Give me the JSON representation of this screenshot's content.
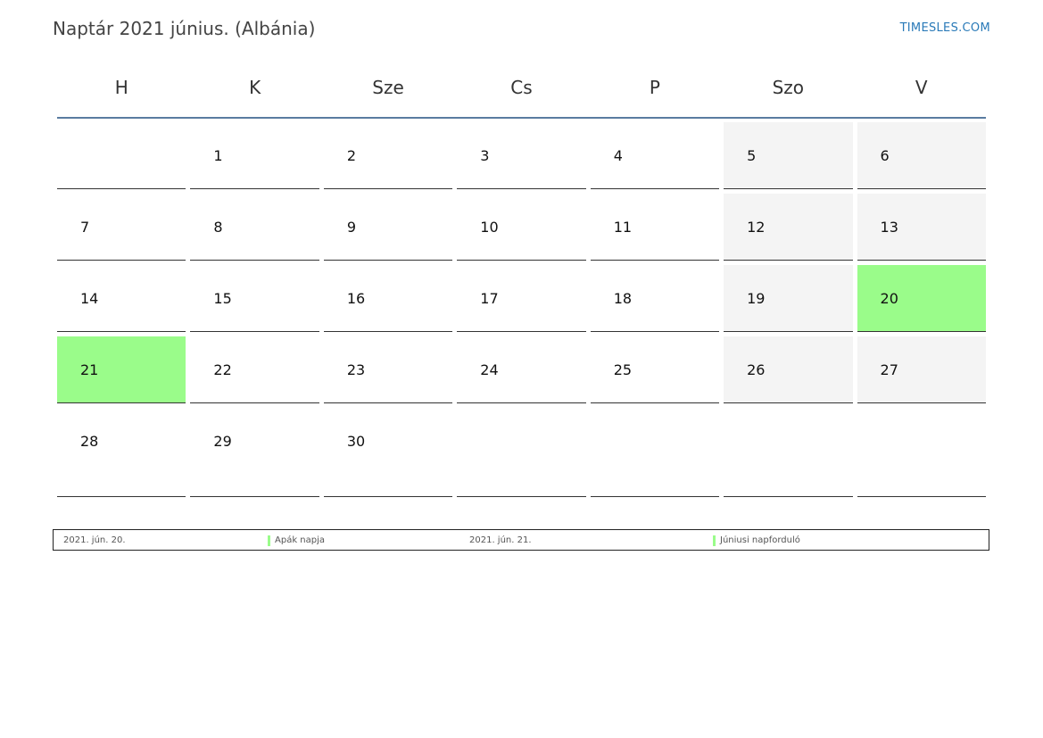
{
  "header": {
    "title": "Naptár 2021 június. (Albánia)",
    "brand": "TIMESLES.COM"
  },
  "colors": {
    "holiday": "#9afc8a",
    "weekend": "#f4f4f4",
    "header_line": "#5a7ca0",
    "brand": "#2a7ab8"
  },
  "weekdays": [
    "H",
    "K",
    "Sze",
    "Cs",
    "P",
    "Szo",
    "V"
  ],
  "weeks": [
    [
      "",
      "1",
      "2",
      "3",
      "4",
      "5",
      "6"
    ],
    [
      "7",
      "8",
      "9",
      "10",
      "11",
      "12",
      "13"
    ],
    [
      "14",
      "15",
      "16",
      "17",
      "18",
      "19",
      "20"
    ],
    [
      "21",
      "22",
      "23",
      "24",
      "25",
      "26",
      "27"
    ],
    [
      "28",
      "29",
      "30",
      "",
      "",
      "",
      ""
    ]
  ],
  "holidays": [
    "20",
    "21"
  ],
  "legend": [
    {
      "date": "2021. jún. 20.",
      "name": "Apák napja"
    },
    {
      "date": "2021. jún. 21.",
      "name": "Júniusi napforduló"
    }
  ]
}
